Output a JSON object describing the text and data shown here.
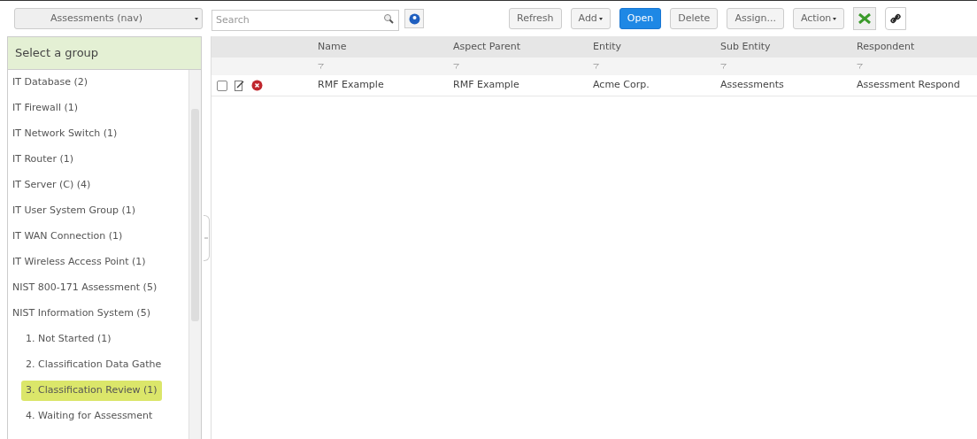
{
  "toolbar": {
    "nav": {
      "label": "Assessments (nav)"
    },
    "search": {
      "placeholder": "Search"
    },
    "buttons": [
      {
        "label": "Refresh",
        "kind": "default",
        "caret": false
      },
      {
        "label": "Add",
        "kind": "default",
        "caret": true
      },
      {
        "label": "Open",
        "kind": "primary",
        "caret": false
      },
      {
        "label": "Delete",
        "kind": "default",
        "caret": false
      },
      {
        "label": "Assign...",
        "kind": "default",
        "caret": false
      },
      {
        "label": "Action",
        "kind": "default",
        "caret": true
      }
    ]
  },
  "sidebar": {
    "title": "Select a group",
    "items": [
      {
        "label": "IT Database (2)",
        "selected": false
      },
      {
        "label": "IT Firewall (1)",
        "selected": false
      },
      {
        "label": "IT Network Switch (1)",
        "selected": false
      },
      {
        "label": "IT Router (1)",
        "selected": false
      },
      {
        "label": "IT Server (C) (4)",
        "selected": false
      },
      {
        "label": "IT User System Group (1)",
        "selected": false
      },
      {
        "label": "IT WAN Connection (1)",
        "selected": false
      },
      {
        "label": "IT Wireless Access Point (1)",
        "selected": false
      },
      {
        "label": "NIST 800-171 Assessment (5)",
        "selected": false
      },
      {
        "label": "NIST Information System (5)",
        "selected": false,
        "children": [
          {
            "label": "1. Not Started (1)",
            "selected": false
          },
          {
            "label": "2. Classification Data Gathe",
            "selected": false
          },
          {
            "label": "3. Classification Review (1)",
            "selected": true
          },
          {
            "label": "4. Waiting for Assessment",
            "selected": false
          }
        ]
      }
    ]
  },
  "table": {
    "columns": [
      "Name",
      "Aspect Parent",
      "Entity",
      "Sub Entity",
      "Respondent"
    ],
    "rows": [
      {
        "checked": false,
        "cells": [
          "RMF Example",
          "RMF Example",
          "Acme Corp.",
          "Assessments",
          "Assessment Respond"
        ]
      }
    ]
  }
}
